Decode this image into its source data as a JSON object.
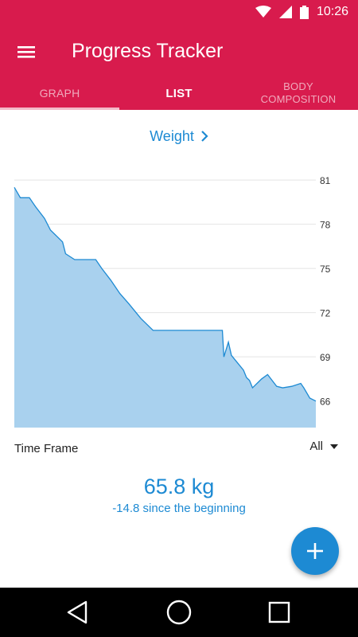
{
  "status_bar": {
    "time": "10:26",
    "icons": [
      "wifi-icon",
      "cellular-signal-icon",
      "battery-icon"
    ]
  },
  "app_bar": {
    "title": "Progress Tracker",
    "menu_icon": "hamburger-menu-icon",
    "background_color": "#d81b4d"
  },
  "tabs": [
    {
      "label": "GRAPH",
      "selected": true
    },
    {
      "label": "LIST",
      "selected": false
    },
    {
      "label_line1": "BODY",
      "label_line2": "COMPOSITION",
      "selected": false
    }
  ],
  "metric_selector": {
    "label": "Weight",
    "icon": "chevron-right-icon"
  },
  "chart_data": {
    "type": "area",
    "yticks": [
      81,
      78,
      75,
      72,
      69,
      66
    ],
    "ylim": [
      64.2,
      81.6
    ],
    "grid": true,
    "fill_color": "#a9d1ee",
    "line_color": "#1d8ad3",
    "x": [
      0,
      0.02,
      0.05,
      0.07,
      0.1,
      0.12,
      0.16,
      0.17,
      0.2,
      0.24,
      0.27,
      0.29,
      0.32,
      0.35,
      0.38,
      0.4,
      0.42,
      0.44,
      0.46,
      0.48,
      0.5,
      0.53,
      0.6,
      0.65,
      0.69,
      0.695,
      0.71,
      0.72,
      0.74,
      0.76,
      0.77,
      0.78,
      0.79,
      0.8,
      0.81,
      0.82,
      0.84,
      0.87,
      0.89,
      0.92,
      0.95,
      0.96,
      0.98,
      1.0
    ],
    "y": [
      80.5,
      79.8,
      79.8,
      79.2,
      78.4,
      77.6,
      76.8,
      76.0,
      75.6,
      75.6,
      75.6,
      75.0,
      74.2,
      73.3,
      72.6,
      72.1,
      71.6,
      71.2,
      70.8,
      70.8,
      70.8,
      70.8,
      70.8,
      70.8,
      70.8,
      69.0,
      70.0,
      69.1,
      68.6,
      68.1,
      67.6,
      67.4,
      66.9,
      67.1,
      67.3,
      67.5,
      67.8,
      67.0,
      66.9,
      67.0,
      67.2,
      66.9,
      66.2,
      66.0
    ]
  },
  "time_frame": {
    "label": "Time Frame",
    "selected": "All",
    "icon": "dropdown-arrow-icon"
  },
  "summary": {
    "current_value": "65.8 kg",
    "change_text": "-14.8 since the beginning"
  },
  "fab": {
    "icon": "plus-icon",
    "color": "#1d8ad3"
  },
  "nav_bar": {
    "icons": [
      "back-icon",
      "home-icon",
      "recents-icon"
    ]
  }
}
